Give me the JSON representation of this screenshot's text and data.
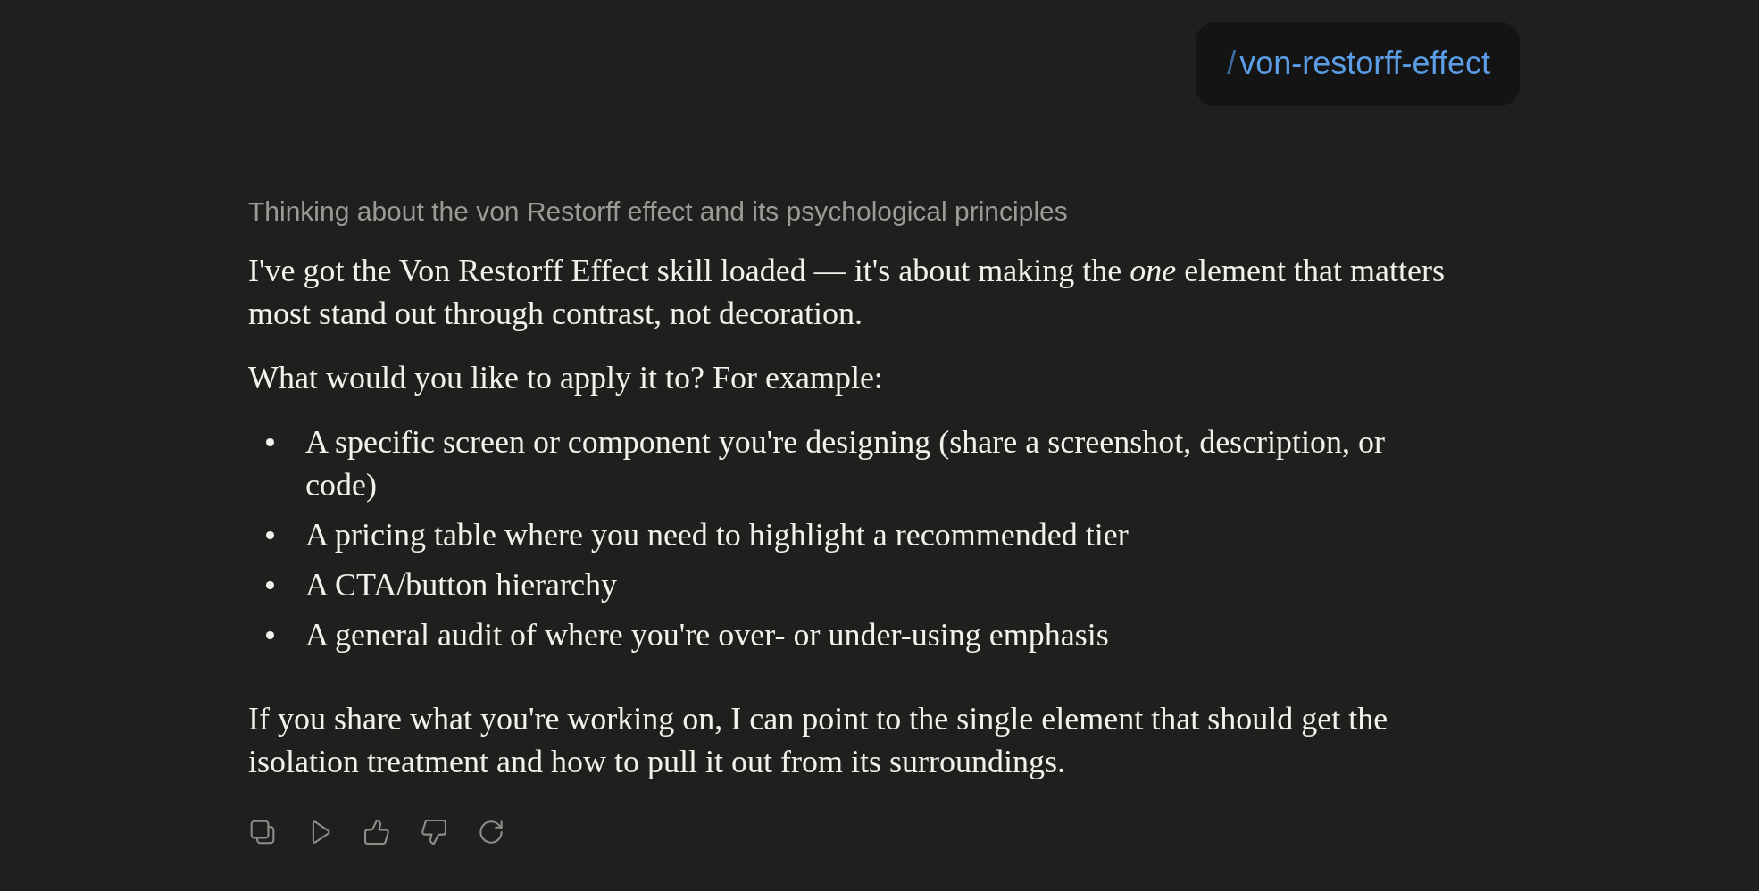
{
  "user_message": {
    "prefix": "/",
    "command": "von-restorff-effect"
  },
  "thinking": {
    "summary": "Thinking about the von Restorff effect and its psychological principles"
  },
  "response": [
    {
      "kind": "paragraph",
      "text": "I've got the Von Restorff Effect skill loaded — it's about making the *one* element that matters most stand out through contrast, not decoration."
    },
    {
      "kind": "paragraph",
      "text": "What would you like to apply it to? For example:"
    },
    {
      "kind": "list",
      "items": [
        "A specific screen or component you're designing (share a screenshot, description, or code)",
        "A pricing table where you need to highlight a recommended tier",
        "A CTA/button hierarchy",
        "A general audit of where you're over- or under-using emphasis"
      ]
    },
    {
      "kind": "paragraph",
      "text": "If you share what you're working on, I can point to the single element that should get the isolation treatment and how to pull it out from its surroundings."
    }
  ]
}
